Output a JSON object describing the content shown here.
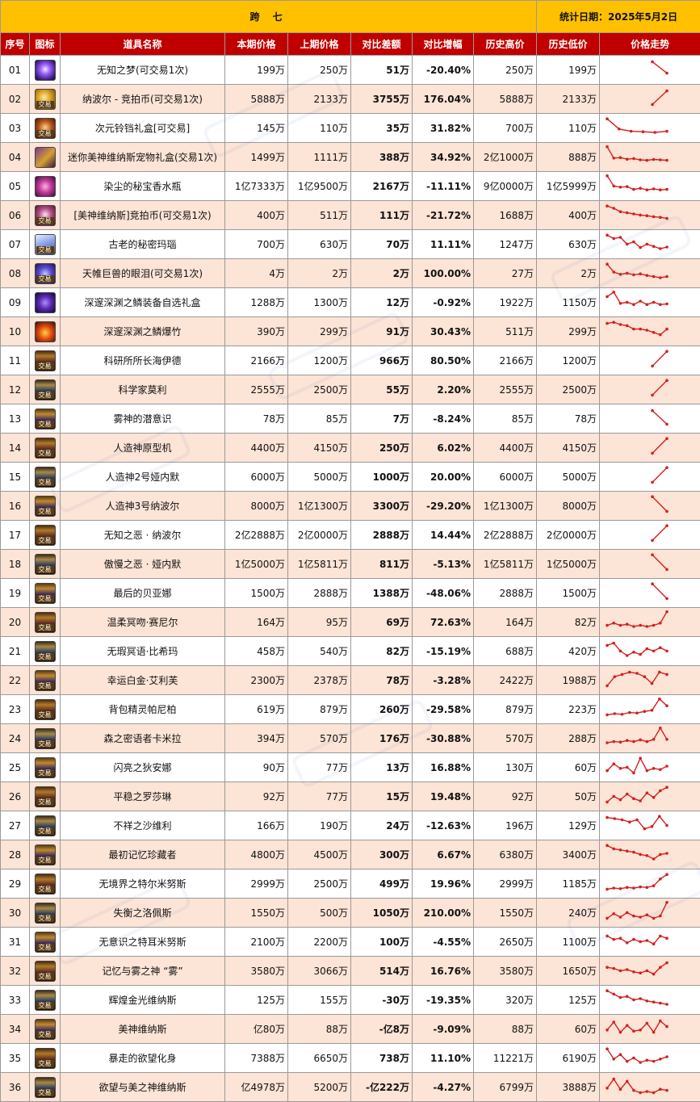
{
  "header": {
    "title": "跨 七",
    "date": "统计日期：2025年5月2日"
  },
  "columns": [
    "序号",
    "图标",
    "道具名称",
    "本期价格",
    "上期价格",
    "对比差额",
    "对比增幅",
    "历史高价",
    "历史低价",
    "价格走势"
  ],
  "colors": {
    "title_bg": "#ffc000",
    "header_bg": "#c00000",
    "row_alt": "#fce4d6",
    "increase": "#e00000",
    "decrease": "#12a34a",
    "trend_line": "#d42020"
  },
  "rows": [
    {
      "idx": "01",
      "icon": "purple-orb-icon",
      "tag": "",
      "name": "无知之梦(可交易1次)",
      "cur": "199万",
      "prev": "250万",
      "diff": "51万",
      "diff_dir": "down",
      "pct": "-20.40%",
      "pct_dir": "down",
      "high": "250万",
      "low": "199万",
      "trend": [
        80,
        30
      ]
    },
    {
      "idx": "02",
      "icon": "gold-coin-icon",
      "tag": "交易",
      "name": "纳波尔 - 竞拍币(可交易1次)",
      "cur": "5888万",
      "prev": "2133万",
      "diff": "3755万",
      "diff_dir": "up",
      "pct": "176.04%",
      "pct_dir": "up",
      "high": "5888万",
      "low": "2133万",
      "trend": [
        20,
        80
      ]
    },
    {
      "idx": "03",
      "icon": "ring-icon",
      "tag": "交易",
      "name": "次元铃铛礼盒[可交易]",
      "cur": "145万",
      "prev": "110万",
      "diff": "35万",
      "diff_dir": "up",
      "pct": "31.82%",
      "pct_dir": "up",
      "high": "700万",
      "low": "110万",
      "trend": [
        85,
        40,
        30,
        28,
        25,
        30
      ]
    },
    {
      "idx": "04",
      "icon": "pet-box-icon",
      "tag": "",
      "name": "迷你美神维纳斯宠物礼盒(交易1次)",
      "cur": "1499万",
      "prev": "1111万",
      "diff": "388万",
      "diff_dir": "up",
      "pct": "34.92%",
      "pct_dir": "up",
      "high": "2亿1000万",
      "low": "888万",
      "trend": [
        90,
        40,
        42,
        35,
        38,
        32,
        30,
        34,
        32,
        30
      ]
    },
    {
      "idx": "05",
      "icon": "perfume-bottle-icon",
      "tag": "",
      "name": "染尘的秘宝香水瓶",
      "cur": "1亿7333万",
      "prev": "1亿9500万",
      "diff": "2167万",
      "diff_dir": "down",
      "pct": "-11.11%",
      "pct_dir": "down",
      "high": "9亿0000万",
      "low": "1亿5999万",
      "trend": [
        90,
        45,
        40,
        42,
        30,
        35,
        28,
        32,
        28,
        30
      ]
    },
    {
      "idx": "06",
      "icon": "venus-coin-icon",
      "tag": "交易",
      "name": "[美神维纳斯]竞拍币(可交易1次)",
      "cur": "400万",
      "prev": "511万",
      "diff": "111万",
      "diff_dir": "down",
      "pct": "-21.72%",
      "pct_dir": "down",
      "high": "1688万",
      "low": "400万",
      "trend": [
        85,
        75,
        60,
        55,
        50,
        45,
        42,
        38,
        35,
        30
      ]
    },
    {
      "idx": "07",
      "icon": "crystal-icon",
      "tag": "交易",
      "name": "古老的秘密玛瑙",
      "cur": "700万",
      "prev": "630万",
      "diff": "70万",
      "diff_dir": "up",
      "pct": "11.11%",
      "pct_dir": "up",
      "high": "1247万",
      "low": "630万",
      "trend": [
        85,
        70,
        75,
        45,
        55,
        30,
        45,
        35,
        25,
        32
      ]
    },
    {
      "idx": "08",
      "icon": "giant-eye-icon",
      "tag": "交易",
      "name": "天帷巨兽的眼泪(可交易1次)",
      "cur": "4万",
      "prev": "2万",
      "diff": "2万",
      "diff_dir": "up",
      "pct": "100.00%",
      "pct_dir": "up",
      "high": "27万",
      "low": "2万",
      "trend": [
        85,
        50,
        40,
        45,
        38,
        42,
        35,
        30,
        25,
        30
      ]
    },
    {
      "idx": "09",
      "icon": "scale-box-icon",
      "tag": "",
      "name": "深邃深渊之鳞装备自选礼盒",
      "cur": "1288万",
      "prev": "1300万",
      "diff": "12万",
      "diff_dir": "down",
      "pct": "-0.92%",
      "pct_dir": "down",
      "high": "1922万",
      "low": "1150万",
      "trend": [
        70,
        90,
        40,
        45,
        35,
        50,
        35,
        45,
        35,
        38
      ]
    },
    {
      "idx": "10",
      "icon": "firecracker-icon",
      "tag": "",
      "name": "深邃深渊之鳞爆竹",
      "cur": "390万",
      "prev": "299万",
      "diff": "91万",
      "diff_dir": "up",
      "pct": "30.43%",
      "pct_dir": "up",
      "high": "511万",
      "low": "299万",
      "trend": [
        80,
        85,
        75,
        70,
        55,
        55,
        50,
        40,
        30,
        55
      ]
    },
    {
      "idx": "11",
      "icon": "haiyide-card-icon",
      "tag": "交易",
      "name": "科研所所长海伊德",
      "cur": "2166万",
      "prev": "1200万",
      "diff": "966万",
      "diff_dir": "up",
      "pct": "80.50%",
      "pct_dir": "up",
      "high": "2166万",
      "low": "1200万",
      "trend": [
        20,
        85
      ]
    },
    {
      "idx": "12",
      "icon": "scientist-card-icon",
      "tag": "交易",
      "name": "科学家莫利",
      "cur": "2555万",
      "prev": "2500万",
      "diff": "55万",
      "diff_dir": "up",
      "pct": "2.20%",
      "pct_dir": "up",
      "high": "2555万",
      "low": "2500万",
      "trend": [
        20,
        85
      ]
    },
    {
      "idx": "13",
      "icon": "mist-card-icon",
      "tag": "交易",
      "name": "雾神的潜意识",
      "cur": "78万",
      "prev": "85万",
      "diff": "7万",
      "diff_dir": "down",
      "pct": "-8.24%",
      "pct_dir": "down",
      "high": "85万",
      "low": "78万",
      "trend": [
        80,
        20
      ]
    },
    {
      "idx": "14",
      "icon": "prototype-card-icon",
      "tag": "交易",
      "name": "人造神原型机",
      "cur": "4400万",
      "prev": "4150万",
      "diff": "250万",
      "diff_dir": "up",
      "pct": "6.02%",
      "pct_dir": "up",
      "high": "4400万",
      "low": "4150万",
      "trend": [
        20,
        85
      ]
    },
    {
      "idx": "15",
      "icon": "artificial-god2-card-icon",
      "tag": "交易",
      "name": "人造神2号娅内默",
      "cur": "6000万",
      "prev": "5000万",
      "diff": "1000万",
      "diff_dir": "up",
      "pct": "20.00%",
      "pct_dir": "up",
      "high": "6000万",
      "low": "5000万",
      "trend": [
        20,
        85
      ]
    },
    {
      "idx": "16",
      "icon": "artificial-god3-card-icon",
      "tag": "交易",
      "name": "人造神3号纳波尔",
      "cur": "8000万",
      "prev": "1亿1300万",
      "diff": "3300万",
      "diff_dir": "down",
      "pct": "-29.20%",
      "pct_dir": "down",
      "high": "1亿1300万",
      "low": "8000万",
      "trend": [
        85,
        20
      ]
    },
    {
      "idx": "17",
      "icon": "ignorance-evil-card-icon",
      "tag": "交易",
      "name": "无知之恶 · 纳波尔",
      "cur": "2亿2888万",
      "prev": "2亿0000万",
      "diff": "2888万",
      "diff_dir": "up",
      "pct": "14.44%",
      "pct_dir": "up",
      "high": "2亿2888万",
      "low": "2亿0000万",
      "trend": [
        20,
        85
      ]
    },
    {
      "idx": "18",
      "icon": "arrogance-evil-card-icon",
      "tag": "交易",
      "name": "傲慢之恶 · 娅内默",
      "cur": "1亿5000万",
      "prev": "1亿5811万",
      "diff": "811万",
      "diff_dir": "down",
      "pct": "-5.13%",
      "pct_dir": "down",
      "high": "1亿5811万",
      "low": "1亿5000万",
      "trend": [
        85,
        20
      ]
    },
    {
      "idx": "19",
      "icon": "beiyana-card-icon",
      "tag": "交易",
      "name": "最后的贝亚娜",
      "cur": "1500万",
      "prev": "2888万",
      "diff": "1388万",
      "diff_dir": "down",
      "pct": "-48.06%",
      "pct_dir": "down",
      "high": "2888万",
      "low": "1500万",
      "trend": [
        85,
        20
      ]
    },
    {
      "idx": "20",
      "icon": "sainier-card-icon",
      "tag": "交易",
      "name": "温柔冥吻·赛尼尔",
      "cur": "164万",
      "prev": "95万",
      "diff": "69万",
      "diff_dir": "up",
      "pct": "72.63%",
      "pct_dir": "up",
      "high": "164万",
      "low": "82万",
      "trend": [
        30,
        40,
        30,
        35,
        25,
        30,
        25,
        30,
        40,
        90
      ]
    },
    {
      "idx": "21",
      "icon": "bixima-card-icon",
      "tag": "交易",
      "name": "无瑕冥语·比希玛",
      "cur": "458万",
      "prev": "540万",
      "diff": "82万",
      "diff_dir": "down",
      "pct": "-15.19%",
      "pct_dir": "down",
      "high": "688万",
      "low": "420万",
      "trend": [
        70,
        80,
        45,
        25,
        40,
        30,
        55,
        45,
        60,
        45
      ]
    },
    {
      "idx": "22",
      "icon": "airuimei-card-icon",
      "tag": "交易",
      "name": "幸运白金·艾利芙",
      "cur": "2300万",
      "prev": "2378万",
      "diff": "78万",
      "diff_dir": "down",
      "pct": "-3.28%",
      "pct_dir": "down",
      "high": "2422万",
      "low": "1988万",
      "trend": [
        20,
        60,
        70,
        80,
        75,
        60,
        30,
        80,
        70
      ]
    },
    {
      "idx": "23",
      "icon": "panibo-card-icon",
      "tag": "交易",
      "name": "背包精灵帕尼柏",
      "cur": "619万",
      "prev": "879万",
      "diff": "260万",
      "diff_dir": "down",
      "pct": "-29.58%",
      "pct_dir": "down",
      "high": "879万",
      "low": "223万",
      "trend": [
        20,
        25,
        22,
        30,
        28,
        35,
        40,
        90,
        60
      ]
    },
    {
      "idx": "24",
      "icon": "kamila-card-icon",
      "tag": "交易",
      "name": "森之密语者卡米拉",
      "cur": "394万",
      "prev": "570万",
      "diff": "176万",
      "diff_dir": "down",
      "pct": "-30.88%",
      "pct_dir": "down",
      "high": "570万",
      "low": "288万",
      "trend": [
        25,
        30,
        28,
        35,
        30,
        38,
        30,
        40,
        90,
        40
      ]
    },
    {
      "idx": "25",
      "icon": "anna-card-icon",
      "tag": "交易",
      "name": "闪亮之狄安娜",
      "cur": "90万",
      "prev": "77万",
      "diff": "13万",
      "diff_dir": "up",
      "pct": "16.88%",
      "pct_dir": "up",
      "high": "130万",
      "low": "60万",
      "trend": [
        30,
        60,
        40,
        45,
        20,
        85,
        30,
        40,
        35,
        50
      ]
    },
    {
      "idx": "26",
      "icon": "shalin-card-icon",
      "tag": "交易",
      "name": "平稳之罗莎琳",
      "cur": "92万",
      "prev": "77万",
      "diff": "15万",
      "diff_dir": "up",
      "pct": "19.48%",
      "pct_dir": "up",
      "high": "92万",
      "low": "50万",
      "trend": [
        20,
        45,
        30,
        55,
        35,
        25,
        60,
        40,
        70,
        85
      ]
    },
    {
      "idx": "27",
      "icon": "shawei-card-icon",
      "tag": "交易",
      "name": "不祥之沙维利",
      "cur": "166万",
      "prev": "190万",
      "diff": "24万",
      "diff_dir": "down",
      "pct": "-12.63%",
      "pct_dir": "down",
      "high": "196万",
      "low": "129万",
      "trend": [
        80,
        75,
        70,
        60,
        70,
        30,
        40,
        85,
        45
      ]
    },
    {
      "idx": "28",
      "icon": "memory-card-icon",
      "tag": "交易",
      "name": "最初记忆珍藏者",
      "cur": "4800万",
      "prev": "4500万",
      "diff": "300万",
      "diff_dir": "up",
      "pct": "6.67%",
      "pct_dir": "up",
      "high": "6380万",
      "low": "3400万",
      "trend": [
        85,
        70,
        65,
        60,
        55,
        45,
        40,
        25,
        45,
        50
      ]
    },
    {
      "idx": "29",
      "icon": "tiernumis-card-icon",
      "tag": "交易",
      "name": "无境界之特尔米努斯",
      "cur": "2999万",
      "prev": "2500万",
      "diff": "499万",
      "diff_dir": "up",
      "pct": "19.96%",
      "pct_dir": "up",
      "high": "2999万",
      "low": "1185万",
      "trend": [
        20,
        25,
        22,
        28,
        25,
        30,
        28,
        35,
        65,
        85
      ]
    },
    {
      "idx": "30",
      "icon": "luopeisi-card-icon",
      "tag": "交易",
      "name": "失衡之洛佩斯",
      "cur": "1550万",
      "prev": "500万",
      "diff": "1050万",
      "diff_dir": "up",
      "pct": "210.00%",
      "pct_dir": "up",
      "high": "1550万",
      "low": "240万",
      "trend": [
        20,
        40,
        25,
        45,
        30,
        25,
        35,
        20,
        30,
        90
      ]
    },
    {
      "idx": "31",
      "icon": "termis-card-icon",
      "tag": "交易",
      "name": "无意识之特耳米努斯",
      "cur": "2100万",
      "prev": "2200万",
      "diff": "100万",
      "diff_dir": "down",
      "pct": "-4.55%",
      "pct_dir": "down",
      "high": "2650万",
      "low": "1100万",
      "trend": [
        70,
        55,
        60,
        40,
        55,
        45,
        50,
        35,
        70,
        60
      ]
    },
    {
      "idx": "32",
      "icon": "mist-god-card-icon",
      "tag": "交易",
      "name": "记忆与雾之神 “雾”",
      "cur": "3580万",
      "prev": "3066万",
      "diff": "514万",
      "diff_dir": "up",
      "pct": "16.76%",
      "pct_dir": "up",
      "high": "3580万",
      "low": "1650万",
      "trend": [
        60,
        55,
        45,
        50,
        40,
        35,
        45,
        30,
        60,
        80
      ]
    },
    {
      "idx": "33",
      "icon": "golden-venus-card-icon",
      "tag": "交易",
      "name": "辉煌金光维纳斯",
      "cur": "125万",
      "prev": "155万",
      "diff": "-30万",
      "diff_dir": "down",
      "pct": "-19.35%",
      "pct_dir": "down",
      "high": "320万",
      "low": "125万",
      "trend": [
        85,
        70,
        55,
        60,
        45,
        50,
        40,
        35,
        30,
        25
      ]
    },
    {
      "idx": "34",
      "icon": "venus-card-icon",
      "tag": "交易",
      "name": "美神维纳斯",
      "cur": "亿80万",
      "prev": "88万",
      "diff": "-亿8万",
      "diff_dir": "down",
      "pct": "-9.09%",
      "pct_dir": "down",
      "high": "88万",
      "low": "60万",
      "trend": [
        40,
        75,
        30,
        60,
        35,
        40,
        70,
        30,
        80,
        55
      ]
    },
    {
      "idx": "35",
      "icon": "desire-card-icon",
      "tag": "交易",
      "name": "暴走的欲望化身",
      "cur": "7388万",
      "prev": "6650万",
      "diff": "738万",
      "diff_dir": "up",
      "pct": "11.10%",
      "pct_dir": "up",
      "high": "11221万",
      "low": "6190万",
      "trend": [
        85,
        40,
        60,
        30,
        45,
        25,
        35,
        30,
        40,
        50
      ]
    },
    {
      "idx": "36",
      "icon": "desire-venus-card-icon",
      "tag": "交易",
      "name": "欲望与美之神维纳斯",
      "cur": "亿4978万",
      "prev": "5200万",
      "diff": "-亿222万",
      "diff_dir": "down",
      "pct": "-4.27%",
      "pct_dir": "down",
      "high": "6799万",
      "low": "3888万",
      "trend": [
        40,
        80,
        35,
        70,
        30,
        20,
        25,
        20,
        35,
        30
      ]
    }
  ]
}
